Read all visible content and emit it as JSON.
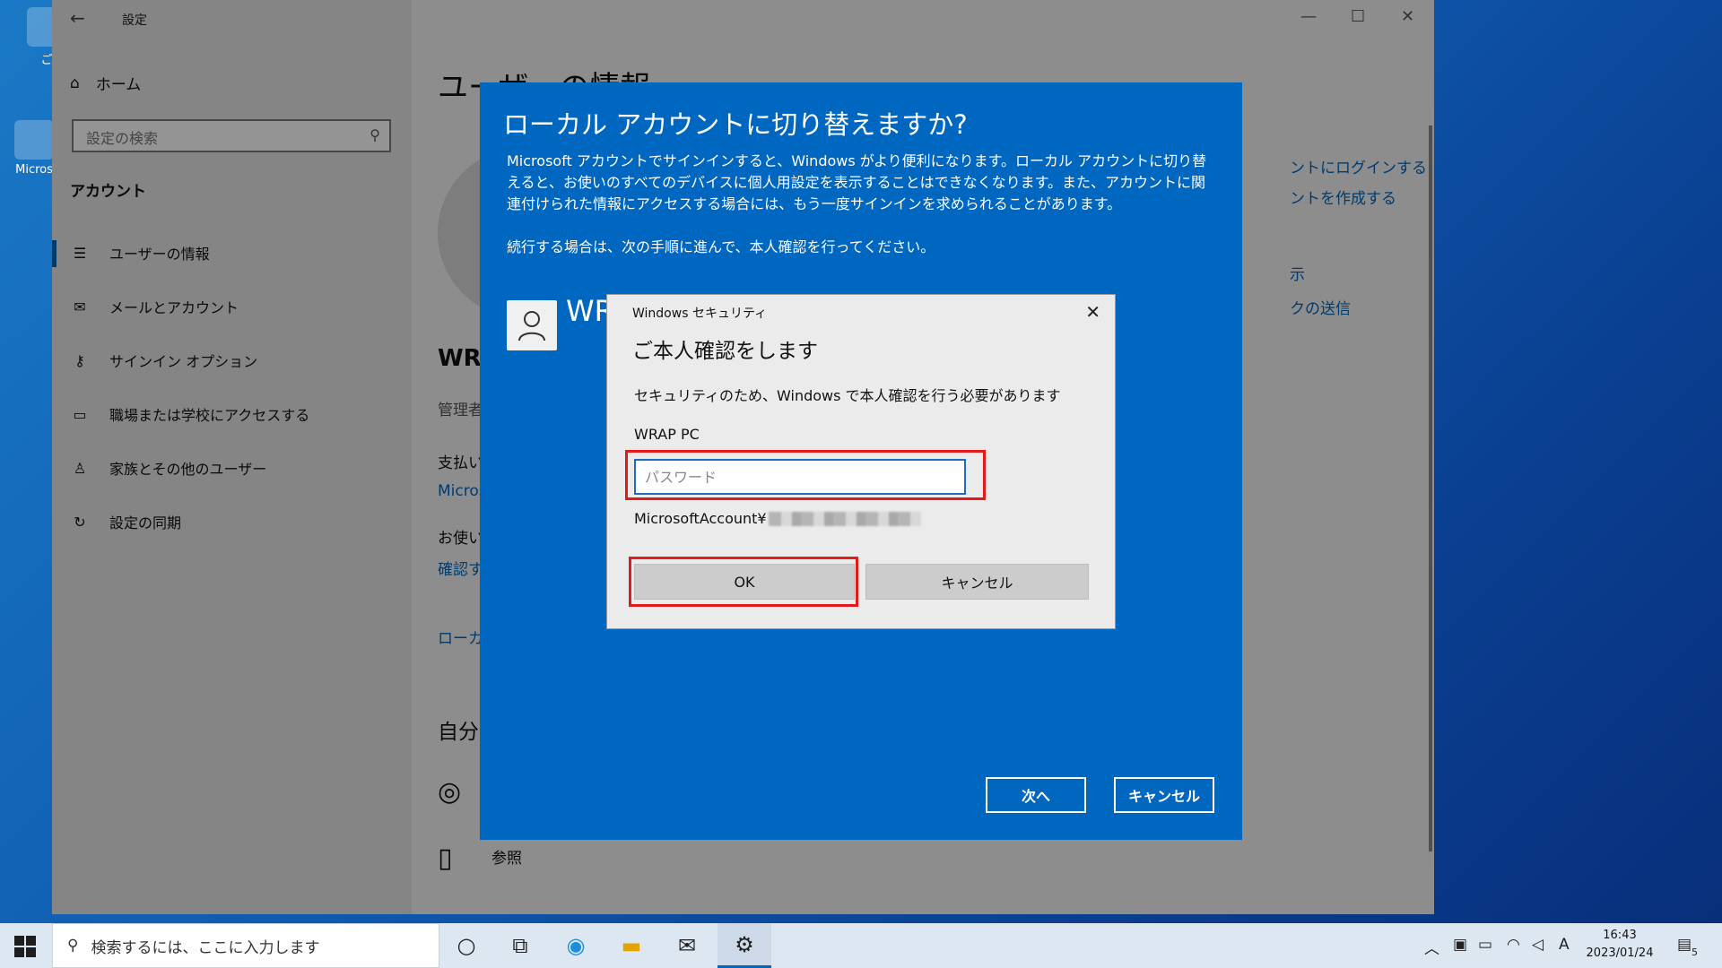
{
  "desktop": {
    "icon1_label": "ご",
    "icon2_label": "Micros"
  },
  "settings": {
    "window_title": "設定",
    "home_label": "ホーム",
    "search_placeholder": "設定の検索",
    "section_title": "アカウント",
    "nav_items": [
      {
        "label": "ユーザーの情報",
        "icon": "user-info-icon"
      },
      {
        "label": "メールとアカウント",
        "icon": "mail-icon"
      },
      {
        "label": "サインイン オプション",
        "icon": "key-icon"
      },
      {
        "label": "職場または学校にアクセスする",
        "icon": "briefcase-icon"
      },
      {
        "label": "家族とその他のユーザー",
        "icon": "person-icon"
      },
      {
        "label": "設定の同期",
        "icon": "sync-icon"
      }
    ],
    "main_heading": "ユーザーの情報",
    "main": {
      "user_name_partial": "WR",
      "role_partial": "管理者",
      "payment_partial": "支払い",
      "ms_link_partial": "Micros",
      "devices_partial": "お使い",
      "verify_link_partial": "確認す",
      "local_link_partial": "ローカル",
      "self_partial": "自分",
      "browse_label": "参照"
    },
    "right_links": [
      "ントにログインする",
      "ントを作成する",
      "示",
      "クの送信"
    ]
  },
  "blue_dialog": {
    "title": "ローカル アカウントに切り替えますか?",
    "paragraph1": "Microsoft アカウントでサインインすると、Windows がより便利になります。ローカル アカウントに切り替えると、お使いのすべてのデバイスに個人用設定を表示することはできなくなります。また、アカウントに関連付けられた情報にアクセスする場合には、もう一度サインインを求められることがあります。",
    "paragraph2": "続行する場合は、次の手順に進んで、本人確認を行ってください。",
    "user_name_partial": "WR",
    "next_button": "次へ",
    "cancel_button": "キャンセル"
  },
  "security_dialog": {
    "title": "Windows セキュリティ",
    "heading": "ご本人確認をします",
    "message": "セキュリティのため、Windows で本人確認を行う必要があります",
    "machine_name": "WRAP PC",
    "password_placeholder": "パスワード",
    "password_value": "",
    "account_prefix": "MicrosoftAccount¥",
    "ok_button": "OK",
    "cancel_button": "キャンセル"
  },
  "taskbar": {
    "search_placeholder": "検索するには、ここに入力します",
    "ime_indicator": "A",
    "time": "16:43",
    "date": "2023/01/24",
    "notification_count": "5"
  },
  "colors": {
    "accent": "#0067c0",
    "highlight_red": "#e21a1a"
  }
}
